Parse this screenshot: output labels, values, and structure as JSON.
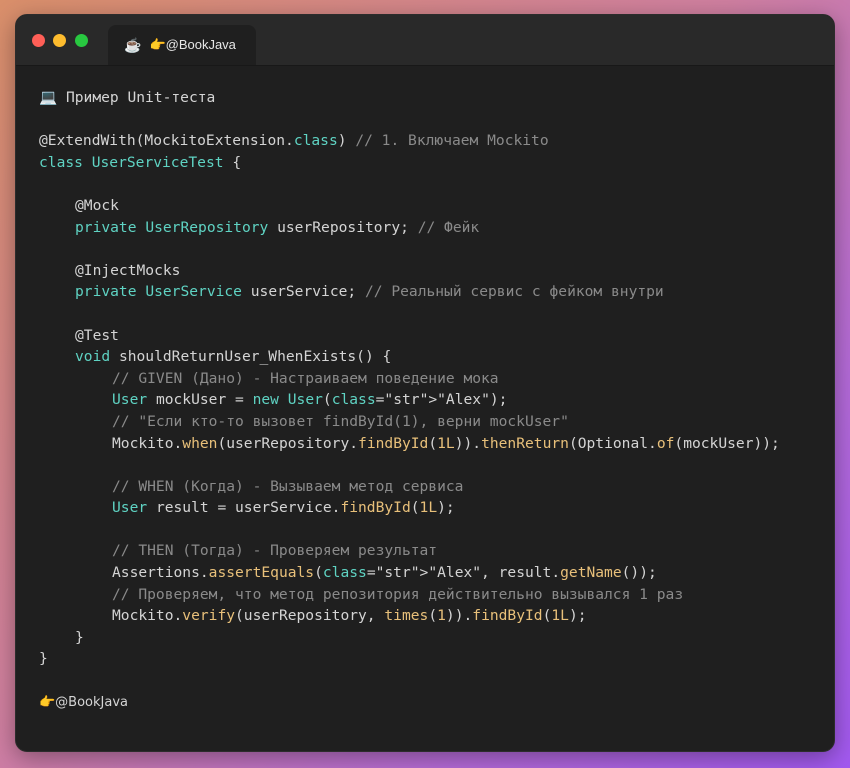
{
  "window": {
    "tab_icon": "coffee-cup-icon",
    "tab_label": "👉@BookJava"
  },
  "code": {
    "header": "💻 Пример Unit-теста",
    "footer": "👉@BookJava",
    "lines": [
      "@ExtendWith(MockitoExtension.class) // 1. Включаем Mockito",
      "class UserServiceTest {",
      "@Mock",
      "private UserRepository userRepository; // Фейк",
      "@InjectMocks",
      "private UserService userService; // Реальный сервис с фейком внутри",
      "@Test",
      "void shouldReturnUser_WhenExists() {",
      "// GIVEN (Дано) - Настраиваем поведение мока",
      "User mockUser = new User(\"Alex\");",
      "// \"Если кто-то вызовет findById(1), верни mockUser\"",
      "Mockito.when(userRepository.findById(1L)).thenReturn(Optional.of(mockUser));",
      "// WHEN (Когда) - Вызываем метод сервиса",
      "User result = userService.findById(1L);",
      "// THEN (Тогда) - Проверяем результат",
      "Assertions.assertEquals(\"Alex\", result.getName());",
      "// Проверяем, что метод репозитория действительно вызывался 1 раз",
      "Mockito.verify(userRepository, times(1)).findById(1L);",
      "}",
      "}"
    ]
  }
}
